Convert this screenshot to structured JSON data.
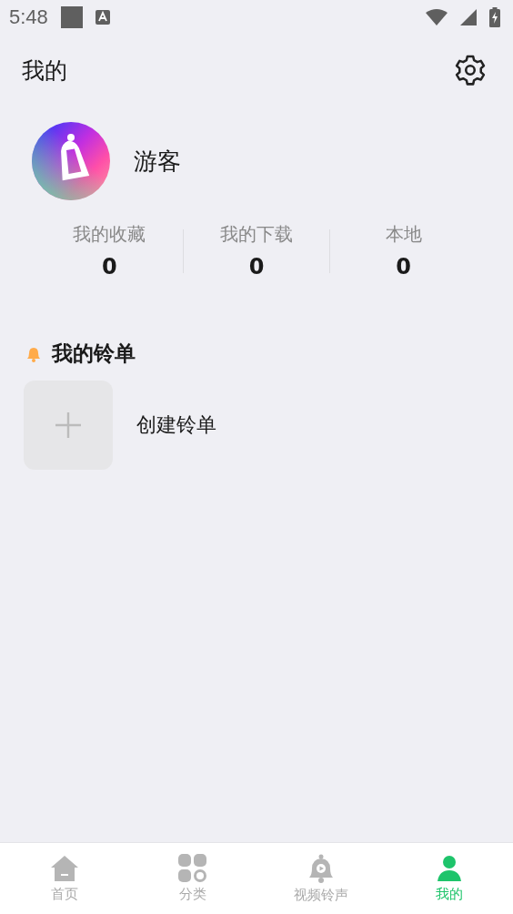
{
  "status_bar": {
    "time": "5:48"
  },
  "header": {
    "title": "我的"
  },
  "profile": {
    "name": "游客"
  },
  "stats": [
    {
      "label": "我的收藏",
      "value": "0"
    },
    {
      "label": "我的下载",
      "value": "0"
    },
    {
      "label": "本地",
      "value": "0"
    }
  ],
  "ringlists": {
    "title": "我的铃单",
    "create_label": "创建铃单"
  },
  "bottom_nav": [
    {
      "label": "首页",
      "kind": "home",
      "selected": false
    },
    {
      "label": "分类",
      "kind": "category",
      "selected": false
    },
    {
      "label": "视频铃声",
      "kind": "video",
      "selected": false
    },
    {
      "label": "我的",
      "kind": "me",
      "selected": true
    }
  ]
}
